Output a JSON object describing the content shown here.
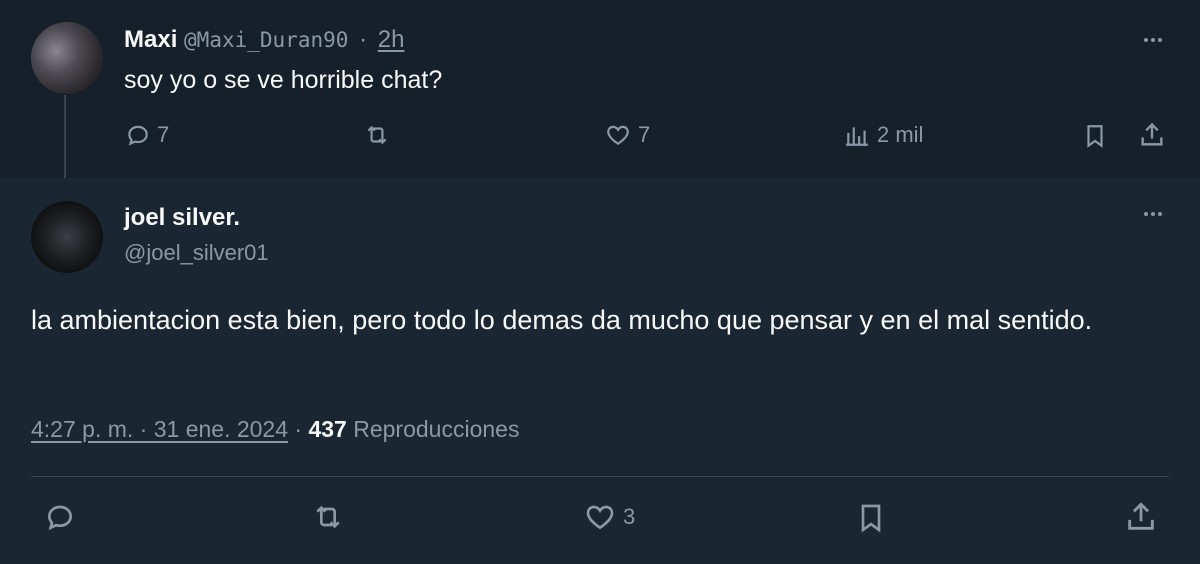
{
  "parent_tweet": {
    "author_name": "Maxi",
    "author_handle": "@Maxi_Duran90",
    "separator": "·",
    "time": "2h",
    "text": "soy yo o se ve horrible chat?",
    "replies": "7",
    "likes": "7",
    "views": "2 mil",
    "avatar_icon": "user-avatar"
  },
  "focused_tweet": {
    "author_name": "joel silver.",
    "author_handle": "@joel_silver01",
    "text": "la ambientacion esta bien, pero todo lo demas da mucho que pensar y en el mal sentido.",
    "timestamp": "4:27 p. m. · 31 ene. 2024",
    "separator": "·",
    "views_count": "437",
    "views_label": "Reproducciones",
    "likes": "3",
    "avatar_icon": "user-avatar"
  },
  "colors": {
    "background": "#15202b",
    "text": "#f7f9f9",
    "muted": "#8b98a5",
    "divider": "#38444d"
  }
}
